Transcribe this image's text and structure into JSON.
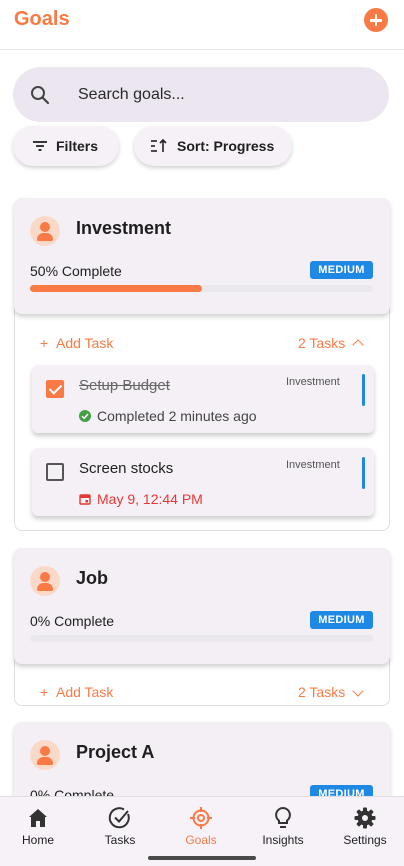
{
  "header": {
    "title": "Goals",
    "add_icon": "add-circle-icon"
  },
  "search": {
    "placeholder": "Search goals...",
    "icon": "search-icon"
  },
  "chips": {
    "filters": "Filters",
    "sort": "Sort: Progress"
  },
  "colors": {
    "accent": "#f97a45",
    "badge": "#1e88e5",
    "due": "#e53935",
    "done": "#43a047"
  },
  "goals": [
    {
      "name": "Investment",
      "progress_label": "50% Complete",
      "progress": 0.5,
      "priority": "MEDIUM",
      "add_task": "Add Task",
      "task_count": "2 Tasks",
      "expanded": true,
      "tasks": [
        {
          "title": "Setup Budget",
          "goal": "Investment",
          "done": true,
          "meta": "Completed 2 minutes ago"
        },
        {
          "title": "Screen stocks",
          "goal": "Investment",
          "done": false,
          "meta": "May 9, 12:44 PM"
        }
      ]
    },
    {
      "name": "Job",
      "progress_label": "0% Complete",
      "progress": 0,
      "priority": "MEDIUM",
      "add_task": "Add Task",
      "task_count": "2 Tasks",
      "expanded": false
    },
    {
      "name": "Project A",
      "progress_label": "0% Complete",
      "progress": 0,
      "priority": "MEDIUM"
    }
  ],
  "nav": [
    {
      "label": "Home",
      "icon": "home-icon"
    },
    {
      "label": "Tasks",
      "icon": "tasks-check-icon"
    },
    {
      "label": "Goals",
      "icon": "target-icon",
      "active": true
    },
    {
      "label": "Insights",
      "icon": "lightbulb-icon"
    },
    {
      "label": "Settings",
      "icon": "gear-icon"
    }
  ]
}
